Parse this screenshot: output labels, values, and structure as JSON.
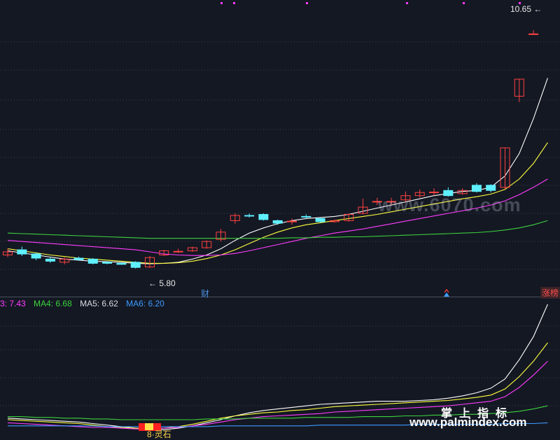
{
  "chart_data": {
    "type": "candlestick",
    "candles": [
      {
        "o": 6.0,
        "c": 6.06,
        "h": 6.12,
        "l": 5.96
      },
      {
        "o": 6.1,
        "c": 6.02,
        "h": 6.16,
        "l": 5.98
      },
      {
        "o": 6.02,
        "c": 5.94,
        "h": 6.05,
        "l": 5.9
      },
      {
        "o": 5.92,
        "c": 5.88,
        "h": 5.95,
        "l": 5.85
      },
      {
        "o": 5.86,
        "c": 5.92,
        "h": 5.95,
        "l": 5.82
      },
      {
        "o": 5.94,
        "c": 5.91,
        "h": 5.97,
        "l": 5.89
      },
      {
        "o": 5.92,
        "c": 5.84,
        "h": 5.94,
        "l": 5.82
      },
      {
        "o": 5.86,
        "c": 5.84,
        "h": 5.88,
        "l": 5.82
      },
      {
        "o": 5.84,
        "c": 5.82,
        "h": 5.86,
        "l": 5.81
      },
      {
        "o": 5.86,
        "c": 5.76,
        "h": 5.88,
        "l": 5.74
      },
      {
        "o": 5.77,
        "c": 5.95,
        "h": 5.98,
        "l": 5.75
      },
      {
        "o": 6.0,
        "c": 6.08,
        "h": 6.1,
        "l": 5.98
      },
      {
        "o": 6.06,
        "c": 6.07,
        "h": 6.12,
        "l": 6.04
      },
      {
        "o": 6.08,
        "c": 6.14,
        "h": 6.16,
        "l": 6.06
      },
      {
        "o": 6.14,
        "c": 6.26,
        "h": 6.28,
        "l": 6.12
      },
      {
        "o": 6.3,
        "c": 6.44,
        "h": 6.5,
        "l": 6.26
      },
      {
        "o": 6.66,
        "c": 6.76,
        "h": 6.8,
        "l": 6.6
      },
      {
        "o": 6.76,
        "c": 6.75,
        "h": 6.8,
        "l": 6.72
      },
      {
        "o": 6.78,
        "c": 6.68,
        "h": 6.8,
        "l": 6.66
      },
      {
        "o": 6.66,
        "c": 6.61,
        "h": 6.68,
        "l": 6.58
      },
      {
        "o": 6.64,
        "c": 6.65,
        "h": 6.7,
        "l": 6.58
      },
      {
        "o": 6.74,
        "c": 6.73,
        "h": 6.78,
        "l": 6.7
      },
      {
        "o": 6.7,
        "c": 6.64,
        "h": 6.72,
        "l": 6.62
      },
      {
        "o": 6.64,
        "c": 6.66,
        "h": 6.68,
        "l": 6.62
      },
      {
        "o": 6.66,
        "c": 6.78,
        "h": 6.8,
        "l": 6.64
      },
      {
        "o": 6.8,
        "c": 6.92,
        "h": 7.08,
        "l": 6.78
      },
      {
        "o": 7.02,
        "c": 7.03,
        "h": 7.1,
        "l": 6.96
      },
      {
        "o": 7.02,
        "c": 7.03,
        "h": 7.1,
        "l": 6.96
      },
      {
        "o": 7.06,
        "c": 7.14,
        "h": 7.22,
        "l": 7.02
      },
      {
        "o": 7.14,
        "c": 7.2,
        "h": 7.26,
        "l": 7.1
      },
      {
        "o": 7.2,
        "c": 7.21,
        "h": 7.28,
        "l": 7.14
      },
      {
        "o": 7.24,
        "c": 7.14,
        "h": 7.3,
        "l": 7.12
      },
      {
        "o": 7.18,
        "c": 7.24,
        "h": 7.28,
        "l": 7.16
      },
      {
        "o": 7.34,
        "c": 7.22,
        "h": 7.38,
        "l": 7.2
      },
      {
        "o": 7.34,
        "c": 7.24,
        "h": 7.36,
        "l": 7.2
      },
      {
        "o": 7.3,
        "c": 8.06,
        "h": 8.06,
        "l": 7.26
      },
      {
        "o": 9.05,
        "c": 9.38,
        "h": 9.38,
        "l": 8.94
      },
      {
        "o": 10.25,
        "c": 10.25,
        "h": 10.32,
        "l": 10.25
      }
    ],
    "ma_lines": [
      {
        "color": "#ffffff",
        "points": [
          6.08,
          6.04,
          6.0,
          5.96,
          5.92,
          5.9,
          5.88,
          5.87,
          5.86,
          5.84,
          5.83,
          5.84,
          5.86,
          5.92,
          6.0,
          6.12,
          6.28,
          6.42,
          6.52,
          6.6,
          6.66,
          6.7,
          6.72,
          6.74,
          6.78,
          6.84,
          6.9,
          6.96,
          7.02,
          7.08,
          7.14,
          7.18,
          7.22,
          7.24,
          7.3,
          7.52,
          7.95,
          8.62,
          9.4
        ]
      },
      {
        "color": "#ffff3c",
        "points": [
          6.12,
          6.08,
          6.04,
          6.0,
          5.97,
          5.94,
          5.92,
          5.9,
          5.88,
          5.86,
          5.84,
          5.84,
          5.85,
          5.88,
          5.93,
          6.0,
          6.1,
          6.22,
          6.34,
          6.44,
          6.52,
          6.58,
          6.62,
          6.66,
          6.7,
          6.74,
          6.78,
          6.83,
          6.88,
          6.93,
          6.98,
          7.03,
          7.08,
          7.12,
          7.17,
          7.26,
          7.46,
          7.76,
          8.16
        ]
      },
      {
        "color": "#ff3cff",
        "points": [
          6.28,
          6.26,
          6.24,
          6.22,
          6.2,
          6.18,
          6.16,
          6.14,
          6.12,
          6.1,
          6.06,
          6.02,
          6.0,
          5.99,
          5.99,
          6.0,
          6.03,
          6.08,
          6.14,
          6.2,
          6.26,
          6.32,
          6.37,
          6.42,
          6.46,
          6.5,
          6.55,
          6.6,
          6.65,
          6.7,
          6.75,
          6.8,
          6.85,
          6.9,
          6.96,
          7.04,
          7.16,
          7.3,
          7.46
        ]
      },
      {
        "color": "#3cd23c",
        "points": [
          6.42,
          6.41,
          6.4,
          6.39,
          6.38,
          6.37,
          6.36,
          6.35,
          6.34,
          6.33,
          6.32,
          6.32,
          6.32,
          6.32,
          6.32,
          6.32,
          6.32,
          6.32,
          6.32,
          6.32,
          6.33,
          6.33,
          6.34,
          6.34,
          6.35,
          6.35,
          6.36,
          6.37,
          6.38,
          6.39,
          6.4,
          6.41,
          6.42,
          6.43,
          6.45,
          6.48,
          6.52,
          6.58,
          6.66
        ]
      }
    ],
    "lower_lines": [
      {
        "color": "#ffffff",
        "points": [
          0.22,
          0.21,
          0.2,
          0.19,
          0.18,
          0.17,
          0.15,
          0.13,
          0.11,
          0.09,
          0.07,
          0.07,
          0.09,
          0.12,
          0.16,
          0.2,
          0.25,
          0.29,
          0.32,
          0.34,
          0.36,
          0.38,
          0.4,
          0.41,
          0.42,
          0.43,
          0.44,
          0.44,
          0.44,
          0.45,
          0.46,
          0.48,
          0.51,
          0.55,
          0.61,
          0.73,
          0.98,
          1.28,
          1.7
        ]
      },
      {
        "color": "#ffff3c",
        "points": [
          0.2,
          0.19,
          0.18,
          0.17,
          0.16,
          0.15,
          0.13,
          0.11,
          0.1,
          0.09,
          0.08,
          0.09,
          0.11,
          0.14,
          0.18,
          0.22,
          0.25,
          0.27,
          0.29,
          0.3,
          0.32,
          0.33,
          0.35,
          0.37,
          0.38,
          0.39,
          0.4,
          0.41,
          0.42,
          0.43,
          0.44,
          0.45,
          0.47,
          0.49,
          0.52,
          0.6,
          0.76,
          0.96,
          1.2
        ]
      },
      {
        "color": "#ff3cff",
        "points": [
          0.16,
          0.15,
          0.14,
          0.13,
          0.12,
          0.11,
          0.1,
          0.1,
          0.09,
          0.08,
          0.08,
          0.09,
          0.1,
          0.12,
          0.14,
          0.17,
          0.2,
          0.22,
          0.24,
          0.25,
          0.26,
          0.27,
          0.28,
          0.3,
          0.31,
          0.32,
          0.33,
          0.34,
          0.35,
          0.36,
          0.37,
          0.38,
          0.4,
          0.42,
          0.44,
          0.5,
          0.62,
          0.78,
          0.96
        ]
      },
      {
        "color": "#3cd23c",
        "points": [
          0.24,
          0.24,
          0.23,
          0.23,
          0.22,
          0.22,
          0.21,
          0.21,
          0.2,
          0.2,
          0.2,
          0.2,
          0.2,
          0.2,
          0.21,
          0.21,
          0.21,
          0.22,
          0.22,
          0.22,
          0.22,
          0.23,
          0.23,
          0.23,
          0.23,
          0.24,
          0.24,
          0.24,
          0.25,
          0.25,
          0.26,
          0.26,
          0.27,
          0.27,
          0.28,
          0.29,
          0.31,
          0.34,
          0.38
        ]
      },
      {
        "color": "#3c9bff",
        "points": [
          0.12,
          0.12,
          0.12,
          0.12,
          0.12,
          0.12,
          0.12,
          0.11,
          0.11,
          0.11,
          0.11,
          0.11,
          0.11,
          0.11,
          0.11,
          0.12,
          0.12,
          0.12,
          0.12,
          0.12,
          0.12,
          0.12,
          0.13,
          0.13,
          0.13,
          0.13,
          0.13,
          0.13,
          0.13,
          0.14,
          0.14,
          0.14,
          0.14,
          0.14,
          0.14,
          0.15,
          0.15,
          0.15,
          0.16
        ]
      }
    ],
    "price_range": [
      5.2,
      10.9
    ],
    "high_label": "10.65",
    "low_label": "5.80",
    "legend": [
      {
        "text": "3: 7.43",
        "color": "#ff3cff"
      },
      {
        "text": "MA4: 6.68",
        "color": "#3cd23c"
      },
      {
        "text": "MA5: 6.62",
        "color": "#d8dbe0"
      },
      {
        "text": "MA6: 6.20",
        "color": "#3c9bff"
      }
    ]
  },
  "tags": {
    "cai": "财",
    "zhangbang": "涨榜",
    "bottom_tag": "8·灵石"
  },
  "watermarks": {
    "url1": "www.6070.com",
    "cn": "掌上指标",
    "url2": "www.palmindex.com"
  },
  "colors": {
    "up": "#ff4040",
    "down": "#5ef0ff",
    "background": "#141823",
    "grid": "#3c4250"
  }
}
